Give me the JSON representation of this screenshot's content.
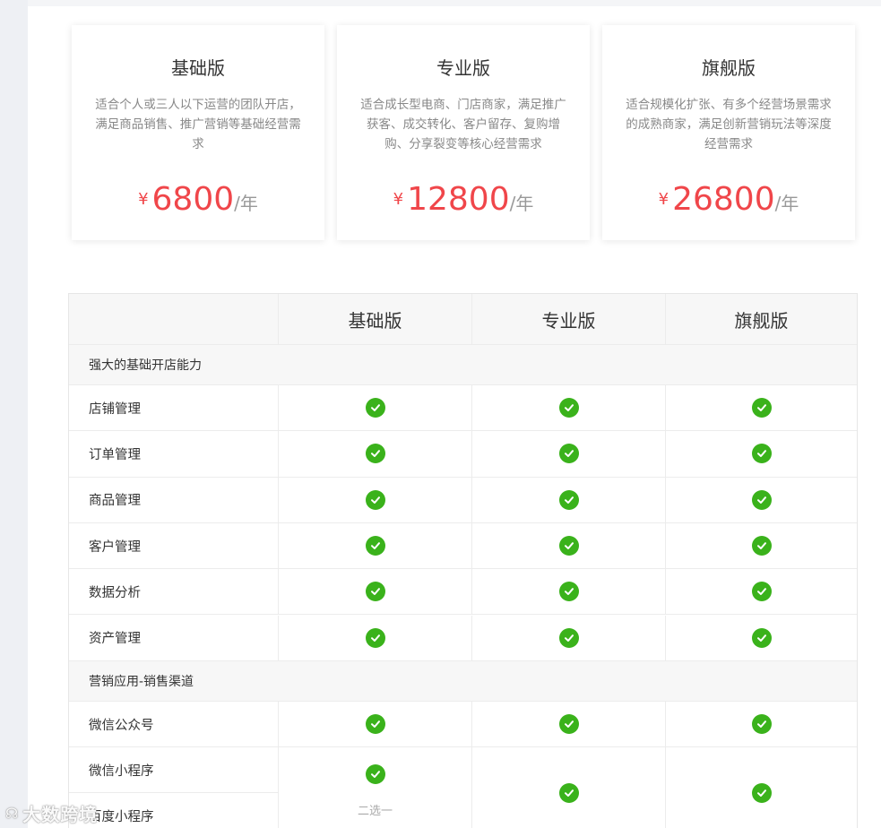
{
  "plans": [
    {
      "name": "基础版",
      "description": "适合个人或三人以下运营的团队开店，满足商品销售、推广营销等基础经营需求",
      "currency": "¥",
      "price": "6800",
      "unit": "/年"
    },
    {
      "name": "专业版",
      "description": "适合成长型电商、门店商家，满足推广获客、成交转化、客户留存、复购增购、分享裂变等核心经营需求",
      "currency": "¥",
      "price": "12800",
      "unit": "/年"
    },
    {
      "name": "旗舰版",
      "description": "适合规模化扩张、有多个经营场景需求的成熟商家，满足创新营销玩法等深度经营需求",
      "currency": "¥",
      "price": "26800",
      "unit": "/年"
    }
  ],
  "table": {
    "headers": [
      "",
      "基础版",
      "专业版",
      "旗舰版"
    ],
    "section1": {
      "title": "强大的基础开店能力",
      "rows": [
        "店铺管理",
        "订单管理",
        "商品管理",
        "客户管理",
        "数据分析",
        "资产管理"
      ]
    },
    "section2": {
      "title": "营销应用-销售渠道",
      "rows": [
        "微信公众号",
        "微信小程序",
        "百度小程序"
      ],
      "choose_one_note": "二选一"
    }
  },
  "watermark": "大数跨境",
  "colors": {
    "price": "#f0464a",
    "check": "#3ab21b",
    "header_bg": "#f7f7f7"
  }
}
